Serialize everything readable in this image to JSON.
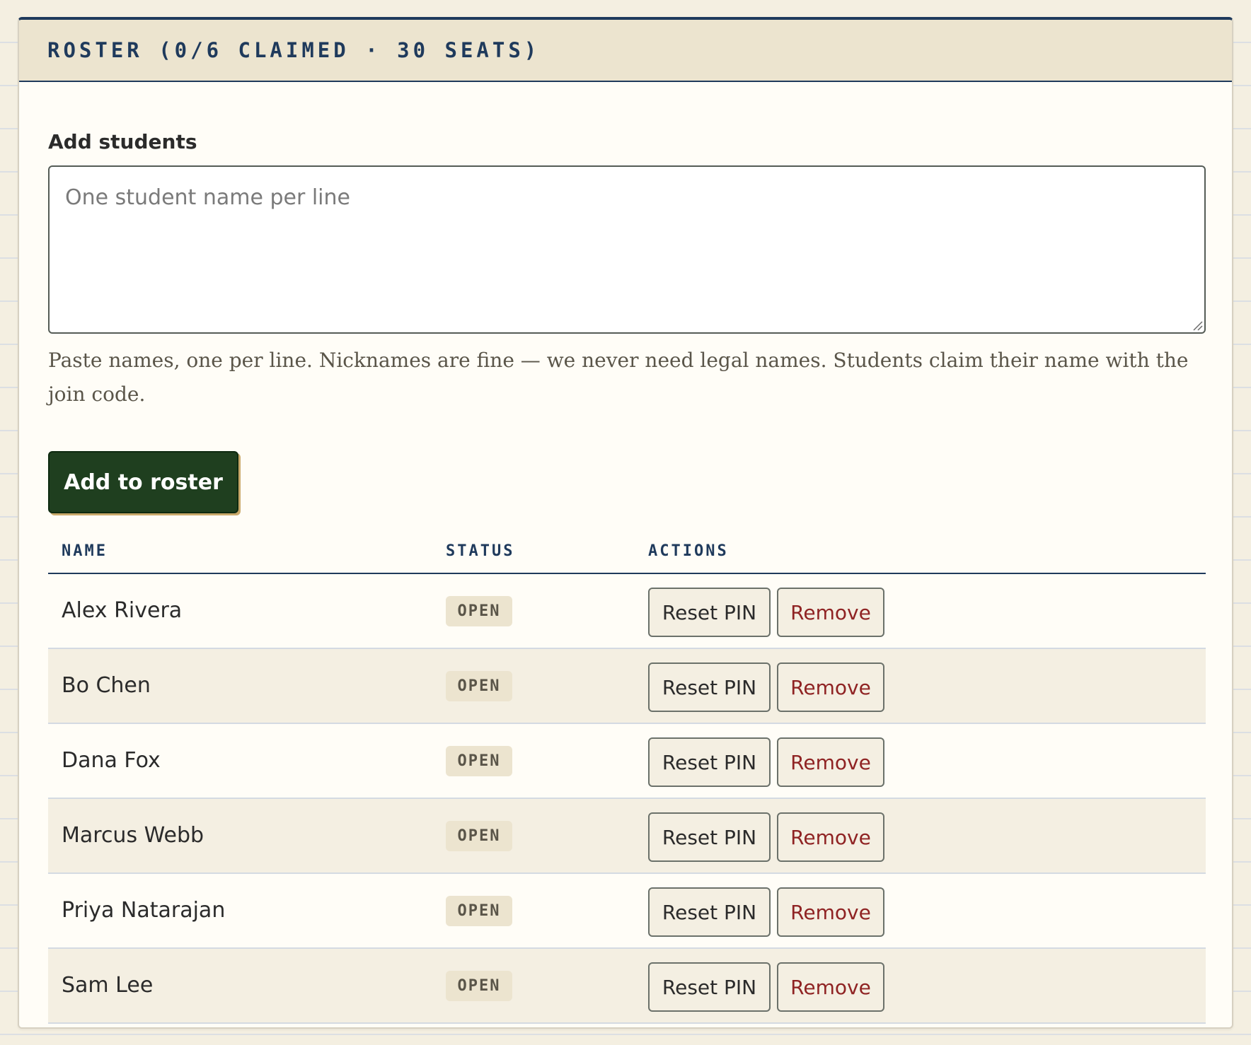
{
  "roster": {
    "title": "ROSTER (0/6 CLAIMED · 30 SEATS)",
    "add_label": "Add students",
    "textarea_placeholder": "One student name per line",
    "textarea_value": "",
    "help_text": "Paste names, one per line. Nicknames are fine — we never need legal names. Students claim their name with the join code.",
    "add_button_label": "Add to roster"
  },
  "table": {
    "headers": {
      "name": "NAME",
      "status": "STATUS",
      "actions": "ACTIONS"
    },
    "rows": [
      {
        "name": "Alex Rivera",
        "status": "OPEN",
        "reset_label": "Reset PIN",
        "remove_label": "Remove"
      },
      {
        "name": "Bo Chen",
        "status": "OPEN",
        "reset_label": "Reset PIN",
        "remove_label": "Remove"
      },
      {
        "name": "Dana Fox",
        "status": "OPEN",
        "reset_label": "Reset PIN",
        "remove_label": "Remove"
      },
      {
        "name": "Marcus Webb",
        "status": "OPEN",
        "reset_label": "Reset PIN",
        "remove_label": "Remove"
      },
      {
        "name": "Priya Natarajan",
        "status": "OPEN",
        "reset_label": "Reset PIN",
        "remove_label": "Remove"
      },
      {
        "name": "Sam Lee",
        "status": "OPEN",
        "reset_label": "Reset PIN",
        "remove_label": "Remove"
      }
    ]
  },
  "colors": {
    "accent_navy": "#1f3a5c",
    "primary_green": "#1f3f1f",
    "danger_red": "#8f2323",
    "paper": "#fffdf7"
  }
}
